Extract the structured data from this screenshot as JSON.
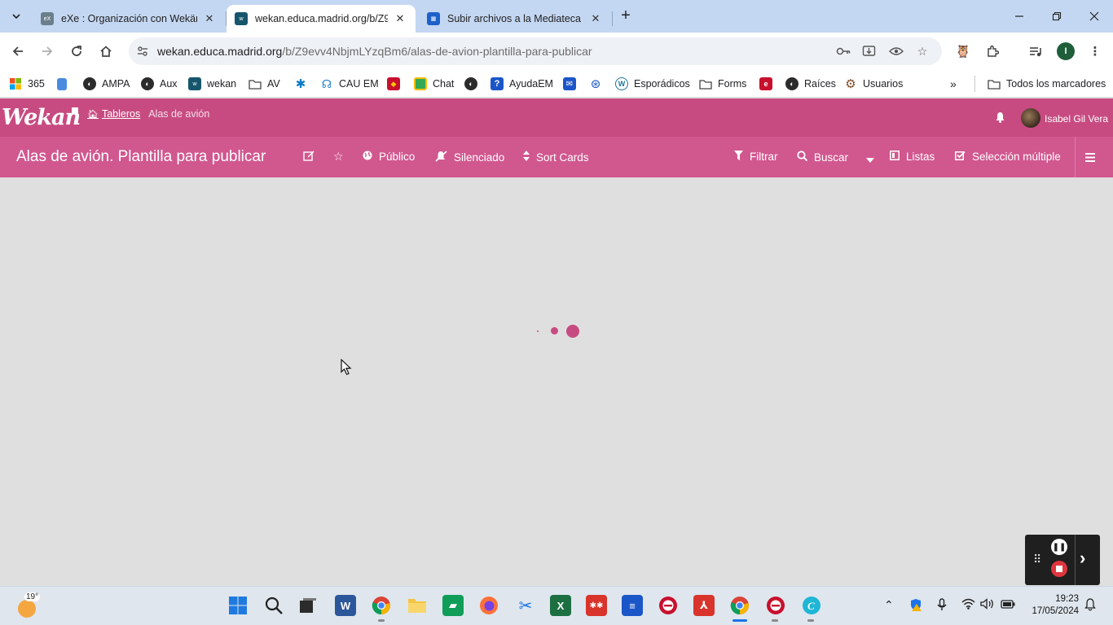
{
  "browser": {
    "tabs": [
      {
        "title": "eXe : Organización con Wekän",
        "active": false
      },
      {
        "title": "wekan.educa.madrid.org/b/Z9e",
        "active": true
      },
      {
        "title": "Subir archivos a la Mediateca | ",
        "active": false
      }
    ],
    "url_host": "wekan.educa.madrid.org",
    "url_path": "/b/Z9evv4NbjmLYzqBm6/alas-de-avion-plantilla-para-publicar",
    "profile_initial": "I"
  },
  "bookmarks": {
    "items": [
      {
        "label": "365",
        "icon": "microsoft-icon"
      },
      {
        "label": "",
        "icon": "doc-icon"
      },
      {
        "label": "AMPA",
        "icon": "globe-icon"
      },
      {
        "label": "Aux",
        "icon": "globe-icon"
      },
      {
        "label": "wekan",
        "icon": "wekan-icon"
      },
      {
        "label": "AV",
        "icon": "folder-icon"
      },
      {
        "label": "",
        "icon": "caixa-icon"
      },
      {
        "label": "CAU EM",
        "icon": "cau-icon"
      },
      {
        "label": "",
        "icon": "spain-icon"
      },
      {
        "label": "Chat",
        "icon": "chat-icon"
      },
      {
        "label": "",
        "icon": "globe-icon"
      },
      {
        "label": "AyudaEM",
        "icon": "help-icon"
      },
      {
        "label": "",
        "icon": "mail-icon"
      },
      {
        "label": "",
        "icon": "aperture-icon"
      },
      {
        "label": "Esporádicos",
        "icon": "wordpress-icon"
      },
      {
        "label": "Forms",
        "icon": "folder-icon"
      },
      {
        "label": "",
        "icon": "edu-icon"
      },
      {
        "label": "Raíces",
        "icon": "globe-icon"
      },
      {
        "label": "Usuarios",
        "icon": "gear-icon"
      }
    ],
    "all_bookmarks": "Todos los marcadores"
  },
  "wekan": {
    "logo": "Wekan",
    "crumb_home": "Tableros",
    "crumb_board": "Alas de avión",
    "user_name": "Isabel Gil Vera",
    "board_title": "Alas de avión. Plantilla para publicar",
    "visibility": "Público",
    "watch": "Silenciado",
    "sort": "Sort Cards",
    "filter": "Filtrar",
    "search": "Buscar",
    "view": "Listas",
    "multiselect": "Selección múltiple",
    "accent_color": "#c74b81",
    "board_bar_color": "#d1578f",
    "state": "loading"
  },
  "taskbar": {
    "temperature": "19°",
    "time": "19:23",
    "date": "17/05/2024"
  }
}
